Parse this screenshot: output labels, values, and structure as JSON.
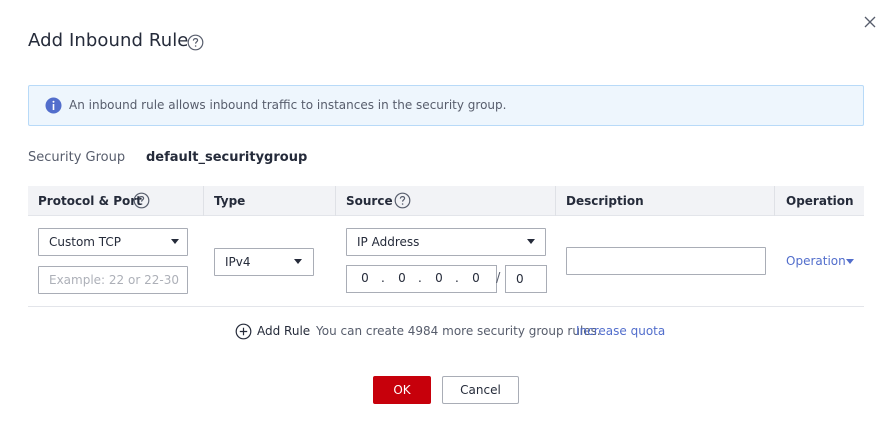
{
  "dialog": {
    "title": "Add Inbound Rule",
    "info_text": "An inbound rule allows inbound traffic to instances in the security group."
  },
  "security_group": {
    "label": "Security Group",
    "value": "default_securitygroup"
  },
  "table": {
    "headers": [
      "Protocol & Port",
      "Type",
      "Source",
      "Description",
      "Operation"
    ],
    "row": {
      "protocol": "Custom TCP",
      "port_placeholder": "Example: 22 or 22-30",
      "type": "IPv4",
      "source_type": "IP Address",
      "ip": [
        "0",
        "0",
        "0",
        "0"
      ],
      "ip_separator": ".",
      "slash": "/",
      "mask": "0",
      "description": "",
      "operation": "Operation"
    }
  },
  "footer": {
    "add_rule": "Add Rule",
    "quota_text": "You can create 4984 more security group rules.",
    "increase_quota": "Increase quota",
    "ok": "OK",
    "cancel": "Cancel"
  },
  "colors": {
    "primary_button": "#c7000b",
    "link": "#526ecc",
    "info_background": "#eef6fd",
    "info_border": "#b8daf8",
    "header_background": "#f2f3f6"
  },
  "icons": [
    "close-icon",
    "help-icon",
    "info-icon",
    "caret-down-icon",
    "add-circle-icon"
  ]
}
